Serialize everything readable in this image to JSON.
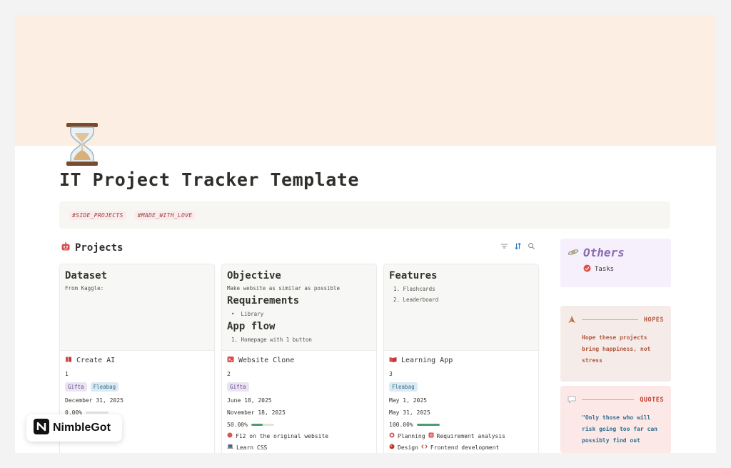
{
  "page": {
    "title": "IT Project Tracker Template",
    "tags": [
      "#SIDE_PROJECTS",
      "#MADE_WITH_LOVE"
    ]
  },
  "projects": {
    "title": "Projects",
    "cards": [
      {
        "cover": {
          "sections": [
            {
              "heading": "Dataset",
              "lines": [
                "From Kaggle:"
              ]
            }
          ]
        },
        "name": "Create AI",
        "number": "1",
        "people": [
          "Gifta",
          "Fleabag"
        ],
        "dates": [
          "December 31, 2025"
        ],
        "progress_label": "0.00%",
        "progress": 0,
        "relations": []
      },
      {
        "cover": {
          "sections": [
            {
              "heading": "Objective",
              "lines": [
                "Make website as similar as possible"
              ]
            },
            {
              "heading": "Requirements",
              "bullets": [
                "Library"
              ]
            },
            {
              "heading": "App flow",
              "numbered": [
                "1. Homepage with 1 button"
              ]
            }
          ]
        },
        "name": "Website Clone",
        "number": "2",
        "people": [
          "Gifta"
        ],
        "dates": [
          "June 18, 2025",
          "November 18, 2025"
        ],
        "progress_label": "50.00%",
        "progress": 50,
        "relations": [
          "F12 on the original website",
          "Learn CSS"
        ]
      },
      {
        "cover": {
          "sections": [
            {
              "heading": "Features",
              "numbered": [
                "1. Flashcards",
                "2. Leaderboard"
              ]
            }
          ]
        },
        "name": "Learning App",
        "number": "3",
        "people": [
          "Fleabag"
        ],
        "dates": [
          "May 1, 2025",
          "May 31, 2025"
        ],
        "progress_label": "100.00%",
        "progress": 100,
        "relations": [
          "Planning",
          "Requirement analysis",
          "Design",
          "Frontend development"
        ]
      }
    ]
  },
  "others": {
    "title": "Others",
    "items": [
      "Tasks"
    ]
  },
  "hopes": {
    "label": "HOPES",
    "text": "Hope these projects bring happiness, not stress"
  },
  "quotes": {
    "label": "QUOTES",
    "text": "\"Only those who will risk going too far can possibly find out"
  },
  "badge": {
    "label": "NimbleGot"
  },
  "colors": {
    "cover": "#fdeee3",
    "tag_text": "#9b3b3b",
    "progress": "#4a9c72",
    "others_accent": "#8a6bb0",
    "hopes_accent": "#b0573f",
    "quotes_accent": "#c0392b",
    "quote_text": "#2f6f8f"
  }
}
